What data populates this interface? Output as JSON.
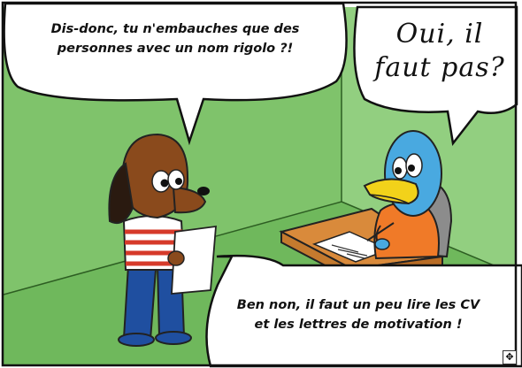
{
  "panel": {
    "bubble_top_left": {
      "line1": "Dis-donc, tu n'embauches que des",
      "line2": "personnes avec un nom rigolo ?!"
    },
    "bubble_top_right": {
      "line1": "Oui, il",
      "line2": "faut pas?"
    },
    "bubble_bottom": {
      "line1": "Ben non, il faut un peu lire les CV",
      "line2": "et les lettres de motivation !"
    }
  },
  "colors": {
    "wall_left": "#7fc36b",
    "wall_right": "#92cf80",
    "floor": "#6fb85c",
    "dog_body": "#8a4a1c",
    "bird_blue": "#49a9e0",
    "bird_beak": "#f2d21a",
    "sweater_orange": "#f07a28"
  },
  "icons": {
    "corner": "expand-icon"
  }
}
